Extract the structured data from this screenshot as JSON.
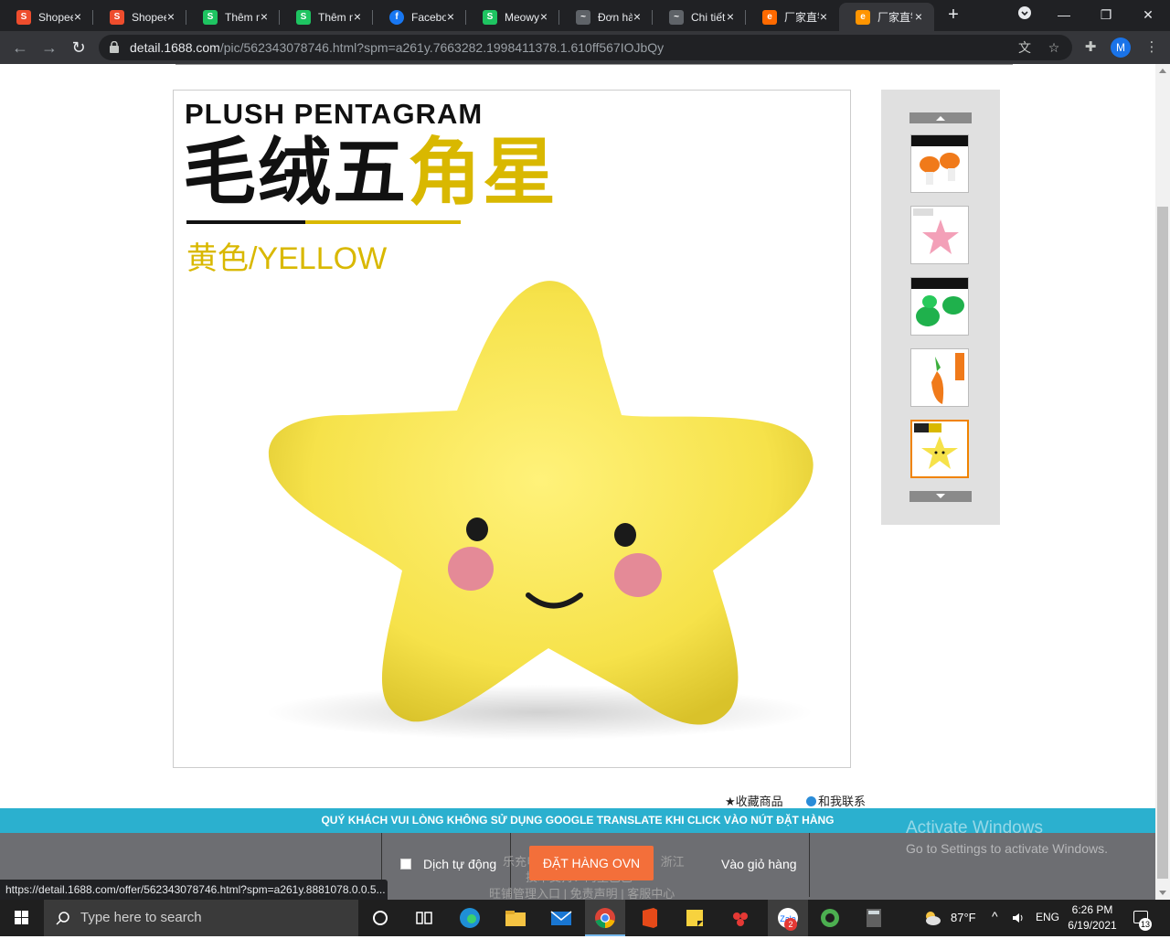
{
  "browser": {
    "tabs": [
      {
        "title": "Shopee",
        "color": "#ee4d2d",
        "glyph": "S"
      },
      {
        "title": "Shopee",
        "color": "#ee4d2d",
        "glyph": "S"
      },
      {
        "title": "Thêm mới",
        "color": "#1ec461",
        "glyph": "S"
      },
      {
        "title": "Thêm mới",
        "color": "#1ec461",
        "glyph": "S"
      },
      {
        "title": "Facebook",
        "color": "#1877f2",
        "glyph": "f"
      },
      {
        "title": "Meowy",
        "color": "#1ec461",
        "glyph": "S"
      },
      {
        "title": "Đơn hàng",
        "color": "#5f6368",
        "glyph": "~"
      },
      {
        "title": "Chi tiết",
        "color": "#5f6368",
        "glyph": "~"
      },
      {
        "title": "厂家直销",
        "color": "#ff6a00",
        "glyph": "e"
      },
      {
        "title": "厂家直销",
        "color": "#ff9500",
        "glyph": "e"
      }
    ],
    "url_host": "detail.1688.com",
    "url_path": "/pic/562343078746.html?spm=a261y.7663282.1998411378.1.610ff567IOJbQy",
    "profile_initial": "M"
  },
  "product": {
    "title_en": "PLUSH PENTAGRAM",
    "title_cn_black": "毛绒五",
    "title_cn_yellow": "角星",
    "color_label": "黄色/YELLOW"
  },
  "links": {
    "favorite": "★收藏商品",
    "contact": "和我联系"
  },
  "extension": {
    "banner": "QUÝ KHÁCH VUI LÒNG KHÔNG SỬ DỤNG GOOGLE TRANSLATE KHI CLICK VÀO NÚT ĐẶT HÀNG",
    "auto_translate_label": "Dịch tự động",
    "order_button": "ĐẶT HÀNG OVN",
    "cart_link": "Vào giỏ hàng"
  },
  "footer_ghost": {
    "line1": "乐充电子商务有限公司  地址：浙江",
    "line2": "技术支持：阿里巴巴",
    "line3": "旺铺管理入口 | 免责声明 | 客服中心"
  },
  "windows": {
    "activate_title": "Activate Windows",
    "activate_sub": "Go to Settings to activate Windows."
  },
  "status_url": "https://detail.1688.com/offer/562343078746.html?spm=a261y.8881078.0.0.5...",
  "taskbar": {
    "search_placeholder": "Type here to search",
    "weather": "87°F",
    "lang": "ENG",
    "time": "6:26 PM",
    "date": "6/19/2021",
    "notification_count": "13",
    "chat_badge": "2"
  }
}
